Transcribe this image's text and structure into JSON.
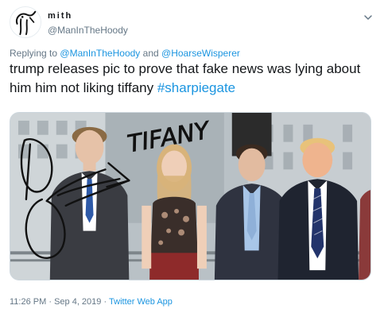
{
  "author": {
    "display_name": "mith",
    "handle": "@ManInTheHoody",
    "avatar_icon": "scribble-figure-avatar"
  },
  "menu_icon": "chevron-down-icon",
  "reply": {
    "prefix": "Replying to",
    "mention_1": "@ManInTheHoody",
    "conjunction": "and",
    "mention_2": "@HoarseWisperer"
  },
  "tweet": {
    "text": "trump releases pic to prove that fake news was lying about him him not liking tiffany",
    "hashtag": "#sharpiegate"
  },
  "photo": {
    "scribble_text": "TIFANY"
  },
  "meta": {
    "time": "11:26 PM",
    "separator_1": "·",
    "date": "Sep 4, 2019",
    "separator_2": "·",
    "source": "Twitter Web App"
  },
  "colors": {
    "link": "#1b95e0",
    "secondary_text": "#657786",
    "primary_text": "#14171a"
  }
}
